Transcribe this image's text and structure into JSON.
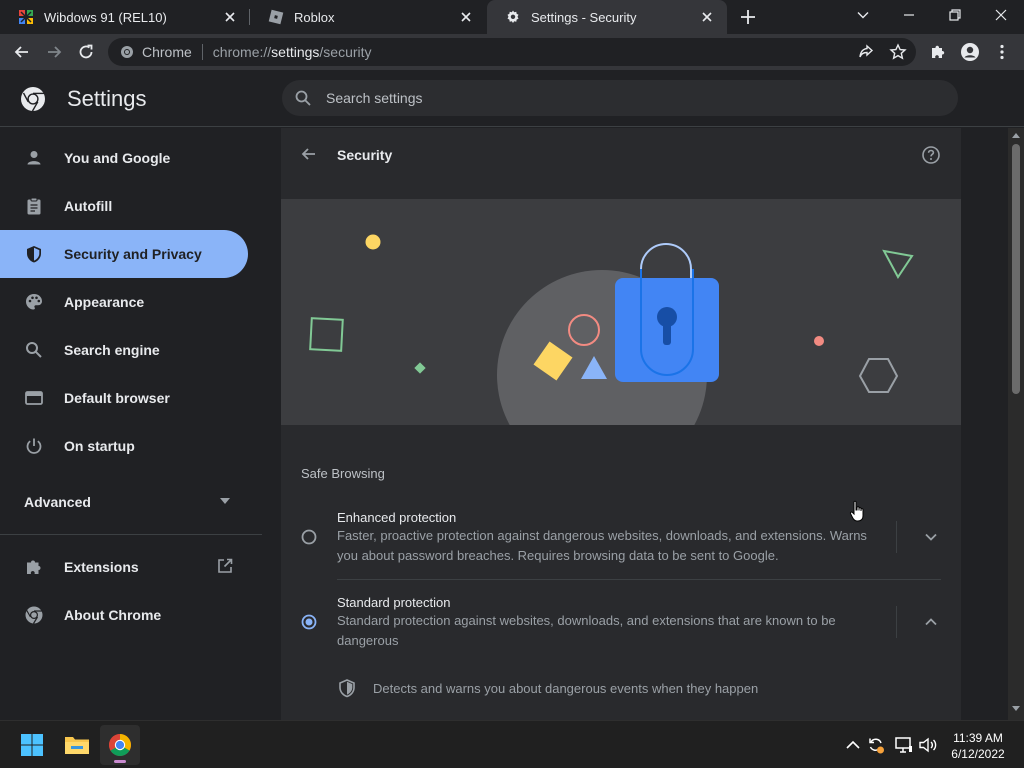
{
  "browser": {
    "tabs": [
      {
        "title": "Wibdows 91 (REL10)",
        "active": false
      },
      {
        "title": "Roblox",
        "active": false
      },
      {
        "title": "Settings - Security",
        "active": true
      }
    ],
    "omnibox": {
      "site_label": "Chrome",
      "url_scheme": "chrome://",
      "url_host": "settings",
      "url_path": "/security"
    }
  },
  "settings": {
    "title": "Settings",
    "search_placeholder": "Search settings",
    "sidebar": {
      "items": [
        {
          "label": "You and Google",
          "icon": "person-icon"
        },
        {
          "label": "Autofill",
          "icon": "clipboard-icon"
        },
        {
          "label": "Security and Privacy",
          "icon": "shield-icon",
          "selected": true
        },
        {
          "label": "Appearance",
          "icon": "palette-icon"
        },
        {
          "label": "Search engine",
          "icon": "search-icon"
        },
        {
          "label": "Default browser",
          "icon": "browser-window-icon"
        },
        {
          "label": "On startup",
          "icon": "power-icon"
        }
      ],
      "advanced_label": "Advanced",
      "extensions_label": "Extensions",
      "about_label": "About Chrome"
    },
    "page": {
      "heading": "Security",
      "section_title": "Safe Browsing",
      "options": [
        {
          "title": "Enhanced protection",
          "description": "Faster, proactive protection against dangerous websites, downloads, and extensions. Warns you about password breaches. Requires browsing data to be sent to Google.",
          "selected": false,
          "expanded": false
        },
        {
          "title": "Standard protection",
          "description": "Standard protection against websites, downloads, and extensions that are known to be dangerous",
          "selected": true,
          "expanded": true
        }
      ],
      "standard_detail": "Detects and warns you about dangerous events when they happen"
    }
  },
  "taskbar": {
    "time": "11:39 AM",
    "date": "6/12/2022"
  },
  "colors": {
    "accent": "#8ab4f8",
    "lock_blue": "#4285f4",
    "background": "#202124",
    "card": "#292a2d"
  }
}
